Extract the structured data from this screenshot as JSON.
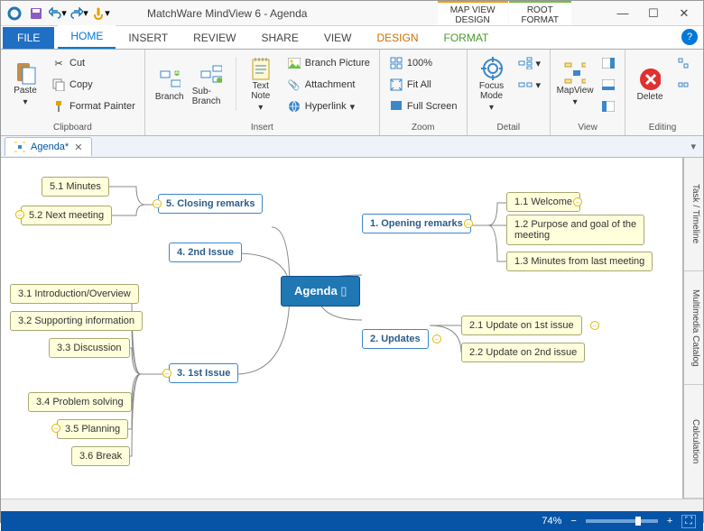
{
  "app_title": "MatchWare MindView 6 - Agenda",
  "context_tabs": {
    "design": "MAP VIEW\nDESIGN",
    "format": "ROOT\nFORMAT"
  },
  "menu": {
    "file": "FILE",
    "home": "HOME",
    "insert": "INSERT",
    "review": "REVIEW",
    "share": "SHARE",
    "view": "VIEW",
    "design": "DESIGN",
    "format": "FORMAT"
  },
  "ribbon": {
    "clipboard": {
      "label": "Clipboard",
      "paste": "Paste",
      "cut": "Cut",
      "copy": "Copy",
      "painter": "Format Painter"
    },
    "insert": {
      "label": "Insert",
      "branch": "Branch",
      "subbranch": "Sub-Branch",
      "textnote": "Text\nNote",
      "picture": "Branch Picture",
      "attachment": "Attachment",
      "hyperlink": "Hyperlink"
    },
    "zoom": {
      "label": "Zoom",
      "p100": "100%",
      "fitall": "Fit All",
      "fullscreen": "Full Screen"
    },
    "detail": {
      "label": "Detail",
      "focus": "Focus\nMode"
    },
    "view": {
      "label": "View",
      "mapview": "MapView"
    },
    "editing": {
      "label": "Editing",
      "delete": "Delete"
    }
  },
  "document_tab": "Agenda*",
  "side_panels": [
    "Task / Timeline",
    "Multimedia Catalog",
    "Calculation"
  ],
  "status": {
    "zoom_pct": "74%"
  },
  "mindmap": {
    "root": "Agenda",
    "t1": {
      "title": "1.  Opening remarks",
      "c1": "1.1  Welcome",
      "c2": "1.2  Purpose and goal of the\n        meeting",
      "c3": "1.3  Minutes from last meeting"
    },
    "t2": {
      "title": "2.  Updates",
      "c1": "2.1  Update on 1st issue",
      "c2": "2.2  Update on 2nd issue"
    },
    "t3": {
      "title": "3.  1st Issue",
      "c1": "3.1  Introduction/Overview",
      "c2": "3.2  Supporting information",
      "c3": "3.3  Discussion",
      "c4": "3.4  Problem solving",
      "c5": "3.5  Planning",
      "c6": "3.6  Break"
    },
    "t4": {
      "title": "4.  2nd Issue"
    },
    "t5": {
      "title": "5.  Closing remarks",
      "c1": "5.1  Minutes",
      "c2": "5.2  Next meeting"
    }
  }
}
